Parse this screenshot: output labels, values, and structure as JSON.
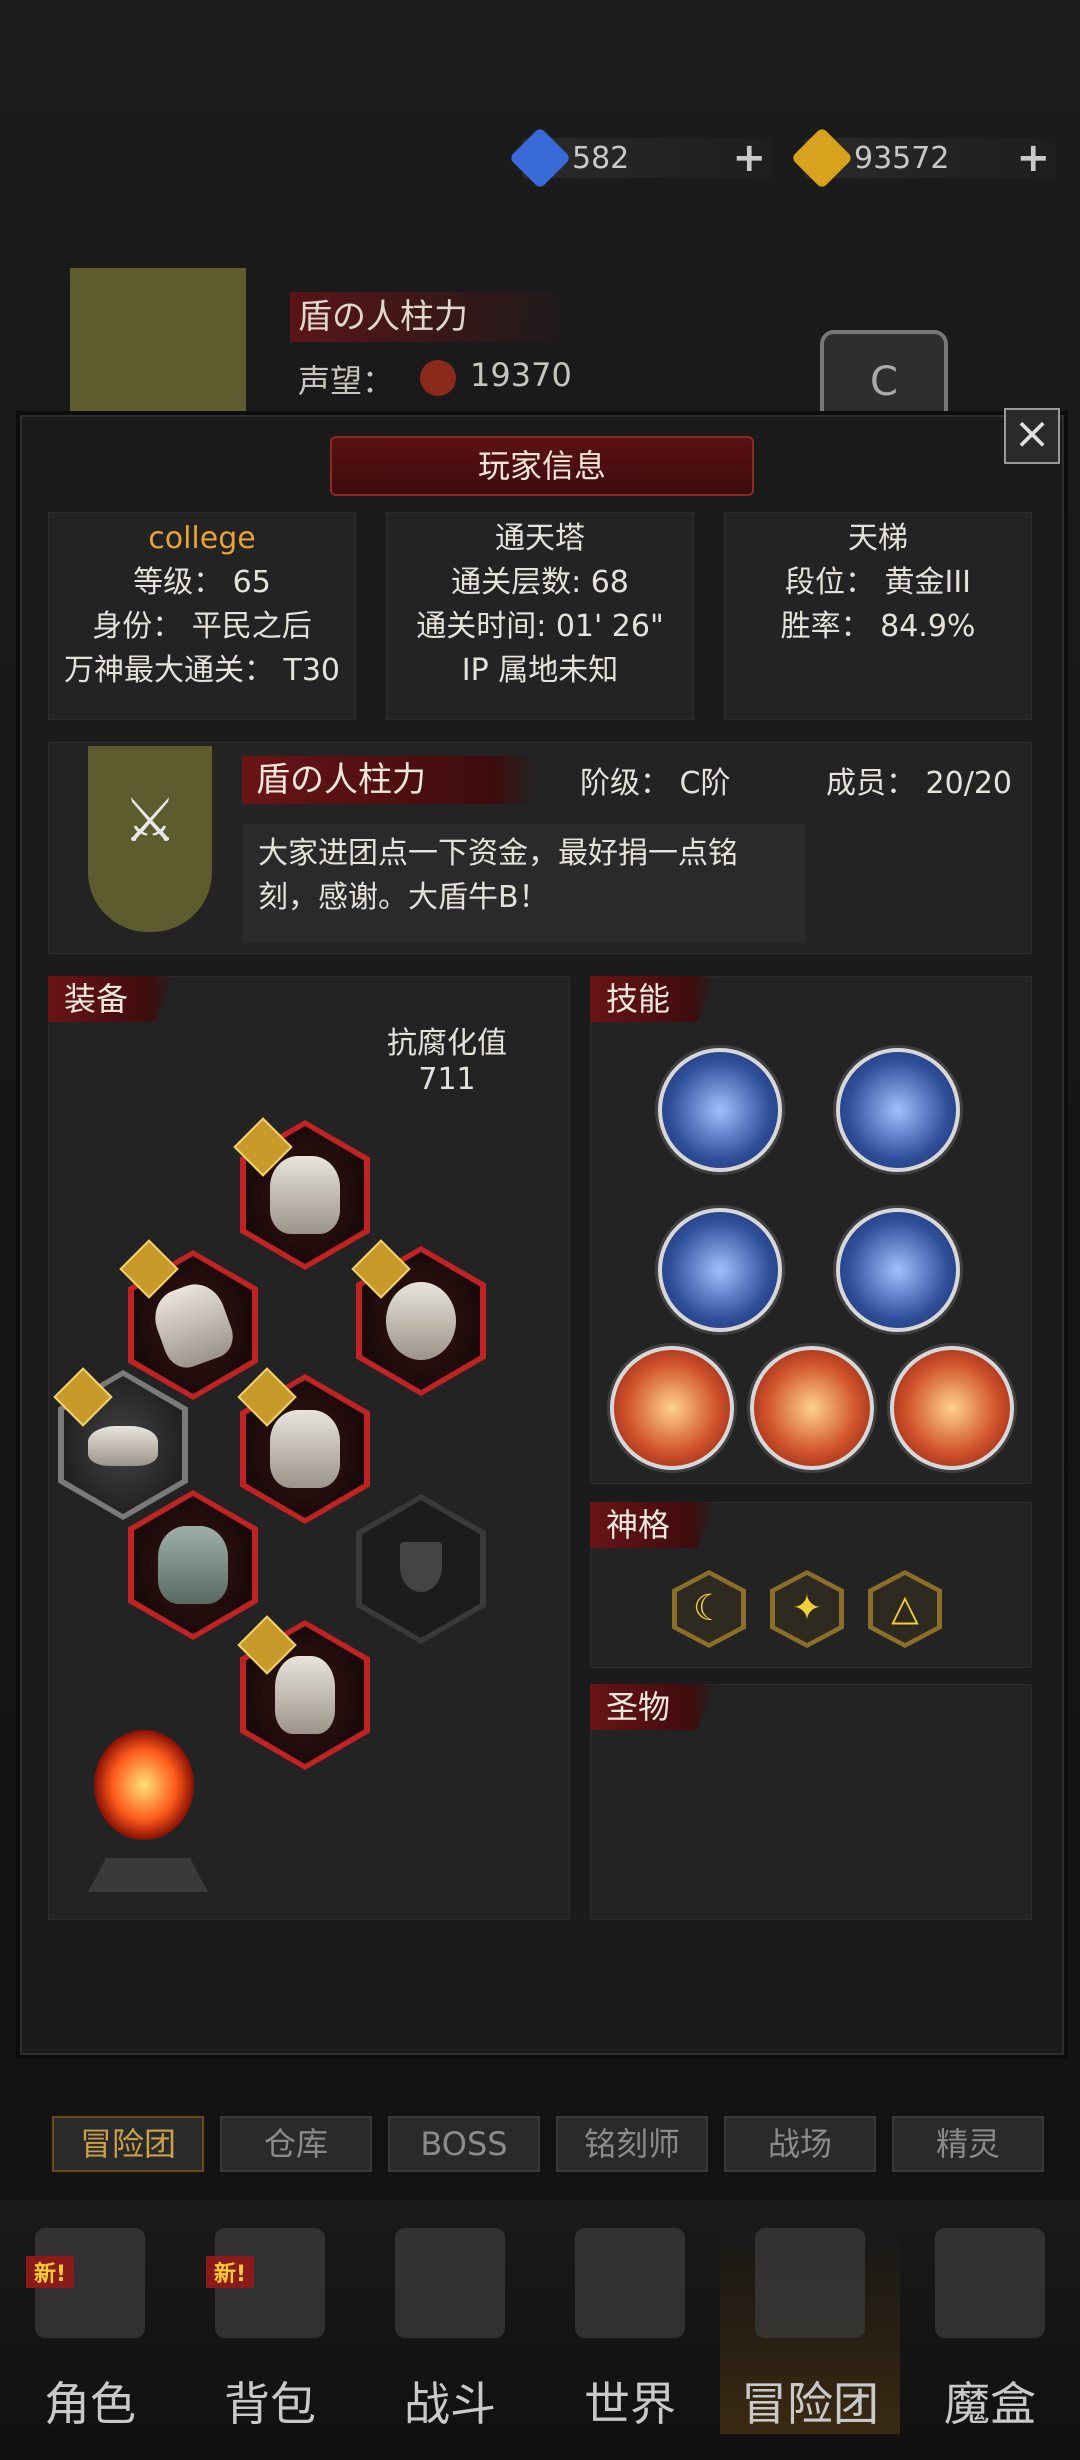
{
  "resources": [
    {
      "icon": "blue-gem-icon",
      "value": "582",
      "color": "#3a6ad8"
    },
    {
      "icon": "gold-gem-icon",
      "value": "93572",
      "color": "#d8a21e"
    }
  ],
  "guild_header": {
    "name": "盾の人柱力",
    "reputation_label": "声望：",
    "reputation_value": "19370",
    "rank_letter": "C"
  },
  "modal": {
    "title": "玩家信息",
    "close_icon": "close-icon"
  },
  "player": {
    "name": "college",
    "level": "等级：  65",
    "identity": "身份：  平民之后",
    "max_clear": "万神最大通关：  T30"
  },
  "tower": {
    "title": "通天塔",
    "floors": "通关层数: 68",
    "time": "通关时间: 01' 26\"",
    "ip": "IP 属地未知"
  },
  "ladder": {
    "title": "天梯",
    "rank": "段位：  黄金III",
    "winrate": "胜率：  84.9%"
  },
  "guild": {
    "name": "盾の人柱力",
    "tier": "阶级：  C阶",
    "members": "成员：  20/20",
    "notice": "大家进团点一下资金，最好捐一点铭刻，感谢。大盾牛B！"
  },
  "equipment": {
    "label": "装备",
    "corruption_label": "抗腐化值",
    "corruption_value": "711"
  },
  "skills": {
    "label": "技能"
  },
  "divinity": {
    "label": "神格"
  },
  "relic": {
    "label": "圣物"
  },
  "sub_tabs": [
    "冒险团",
    "仓库",
    "BOSS",
    "铭刻师",
    "战场",
    "精灵"
  ],
  "nav": [
    {
      "label": "角色",
      "badge": "新!"
    },
    {
      "label": "背包",
      "badge": "新!"
    },
    {
      "label": "战斗",
      "badge": ""
    },
    {
      "label": "世界",
      "badge": ""
    },
    {
      "label": "冒险团",
      "badge": ""
    },
    {
      "label": "魔盒",
      "badge": ""
    }
  ]
}
